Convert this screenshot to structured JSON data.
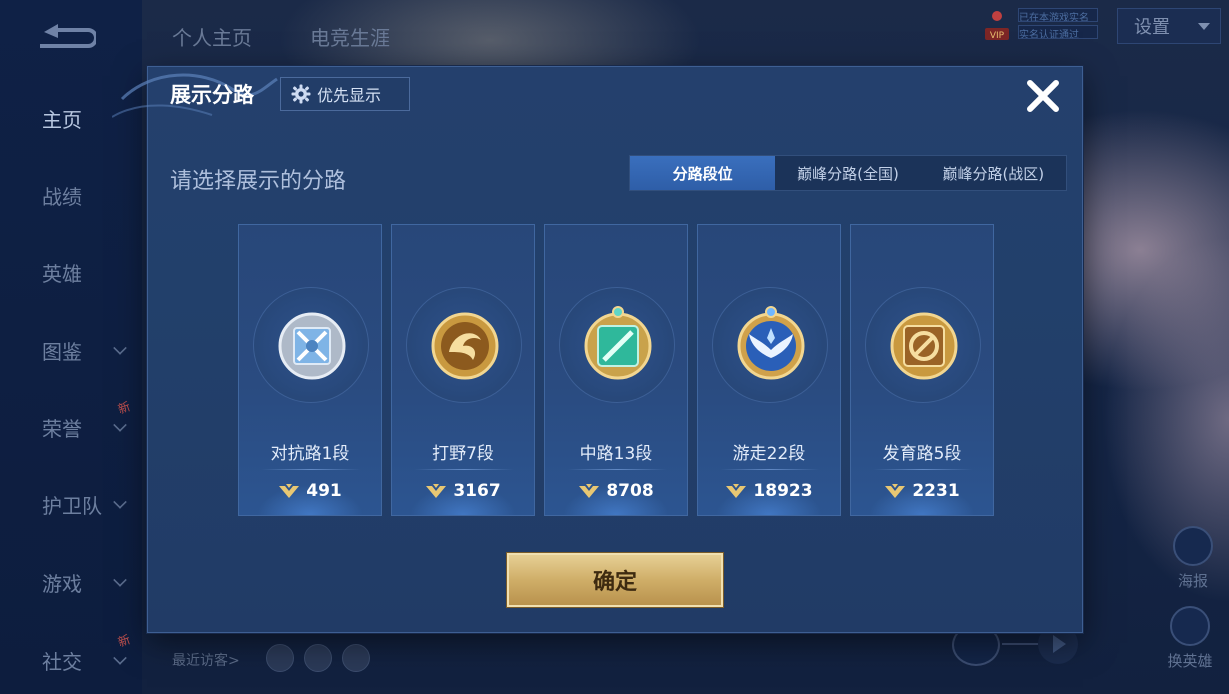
{
  "background": {
    "nav_items": [
      {
        "label": "主页",
        "has_chevron": false,
        "badge": ""
      },
      {
        "label": "战绩",
        "has_chevron": false,
        "badge": ""
      },
      {
        "label": "英雄",
        "has_chevron": false,
        "badge": ""
      },
      {
        "label": "图鉴",
        "has_chevron": true,
        "badge": ""
      },
      {
        "label": "荣誉",
        "has_chevron": true,
        "badge": "新"
      },
      {
        "label": "护卫队",
        "has_chevron": true,
        "badge": ""
      },
      {
        "label": "游戏",
        "has_chevron": true,
        "badge": ""
      },
      {
        "label": "社交",
        "has_chevron": true,
        "badge": "新"
      }
    ],
    "top_tabs": [
      "个人主页",
      "电竞生涯"
    ],
    "settings_label": "设置",
    "vip_label": "VIP",
    "promo_lines": [
      "已在本游戏实名",
      "实名认证通过"
    ],
    "side_buttons": [
      "海报",
      "换英雄"
    ],
    "visitors_label": "最近访客>"
  },
  "modal": {
    "title": "展示分路",
    "priority_button": "优先显示",
    "subtitle": "请选择展示的分路",
    "tabs": [
      {
        "label": "分路段位",
        "active": true
      },
      {
        "label": "巅峰分路(全国)",
        "active": false
      },
      {
        "label": "巅峰分路(战区)",
        "active": false
      }
    ],
    "lanes": [
      {
        "label": "对抗路1段",
        "score": "491",
        "icon": "clash-lane-emblem-icon",
        "tier": "silver"
      },
      {
        "label": "打野7段",
        "score": "3167",
        "icon": "jungle-dragon-emblem-icon",
        "tier": "gold"
      },
      {
        "label": "中路13段",
        "score": "8708",
        "icon": "mid-lane-emblem-icon",
        "tier": "jade"
      },
      {
        "label": "游走22段",
        "score": "18923",
        "icon": "roam-wings-emblem-icon",
        "tier": "blue"
      },
      {
        "label": "发育路5段",
        "score": "2231",
        "icon": "farm-lane-emblem-icon",
        "tier": "gold"
      }
    ],
    "confirm_button": "确定"
  },
  "colors": {
    "accent_blue": "#2e5ea8",
    "gold": "#cfae68",
    "modal_bg": "#22406b"
  }
}
